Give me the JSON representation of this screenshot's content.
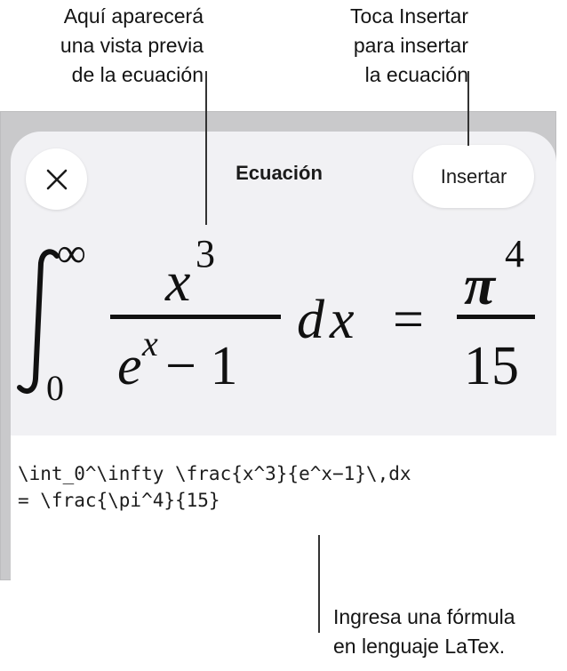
{
  "callouts": {
    "preview": {
      "line1": "Aquí aparecerá",
      "line2": "una vista previa",
      "line3": "de la ecuación"
    },
    "insert": {
      "line1": "Toca Insertar",
      "line2": "para insertar",
      "line3": "la ecuación"
    },
    "latex": {
      "line1": "Ingresa una fórmula",
      "line2": "en lenguaje LaTex."
    }
  },
  "sheet": {
    "title": "Ecuación",
    "insert_label": "Insertar",
    "close_icon": "close-icon"
  },
  "equation": {
    "int_lower": "0",
    "int_upper": "∞",
    "numerator_base": "x",
    "numerator_exp": "3",
    "denominator_base": "e",
    "denominator_exp": "x",
    "denominator_rest": "− 1",
    "differential": "dx",
    "equals": "=",
    "rhs_num_base": "π",
    "rhs_num_exp": "4",
    "rhs_den": "15"
  },
  "editor": {
    "line1": "\\int_0^\\infty \\frac{x^3}{e^x−1}\\,dx",
    "line2": "= \\frac{\\pi^4}{15}"
  }
}
